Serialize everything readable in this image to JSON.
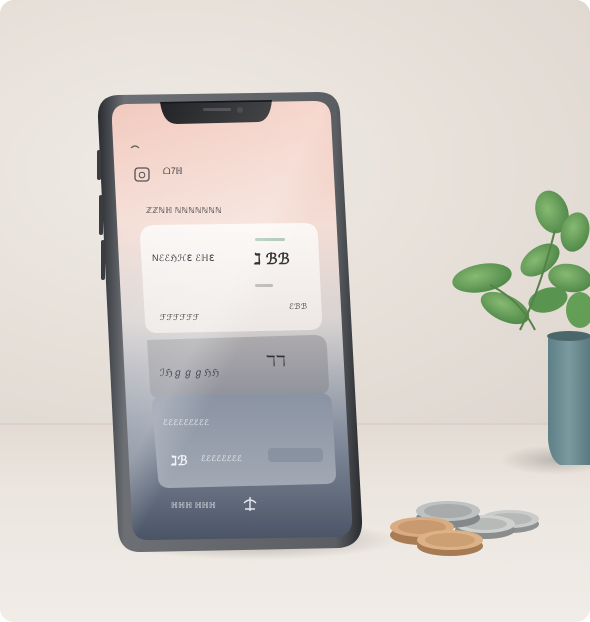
{
  "scene": {
    "background_color": "#e6dfd8",
    "table_color": "#ece6e0"
  },
  "phone_screen": {
    "header_label": "ᗝ7ℍ",
    "subheader_label": "ℤℤℕℍ ℕℕℕℕℕℕℕ",
    "card_1": {
      "title": "Nℰℰℌℋℇ ℰℍℇ",
      "value": "ℷ ℬℬ",
      "footer_left": "ℱℱℱℱℱℱ",
      "footer_right": "ℰℬℬ"
    },
    "card_2": {
      "title": "ℐℌℊℊℊℌℌ",
      "value": "ℸℸ"
    },
    "card_3": {
      "title": "ℰℰℰℰℰℰℰℰℰ",
      "value": "ℷℬ",
      "value_label": "ℰℰℰℰℰℰℰℰ"
    },
    "bottom_left_label": "ℍℍℍ ℍℍℍ",
    "accent_color": "#3e9e6a"
  },
  "icons": [
    "wifi-icon",
    "camera-icon",
    "home-icon"
  ]
}
